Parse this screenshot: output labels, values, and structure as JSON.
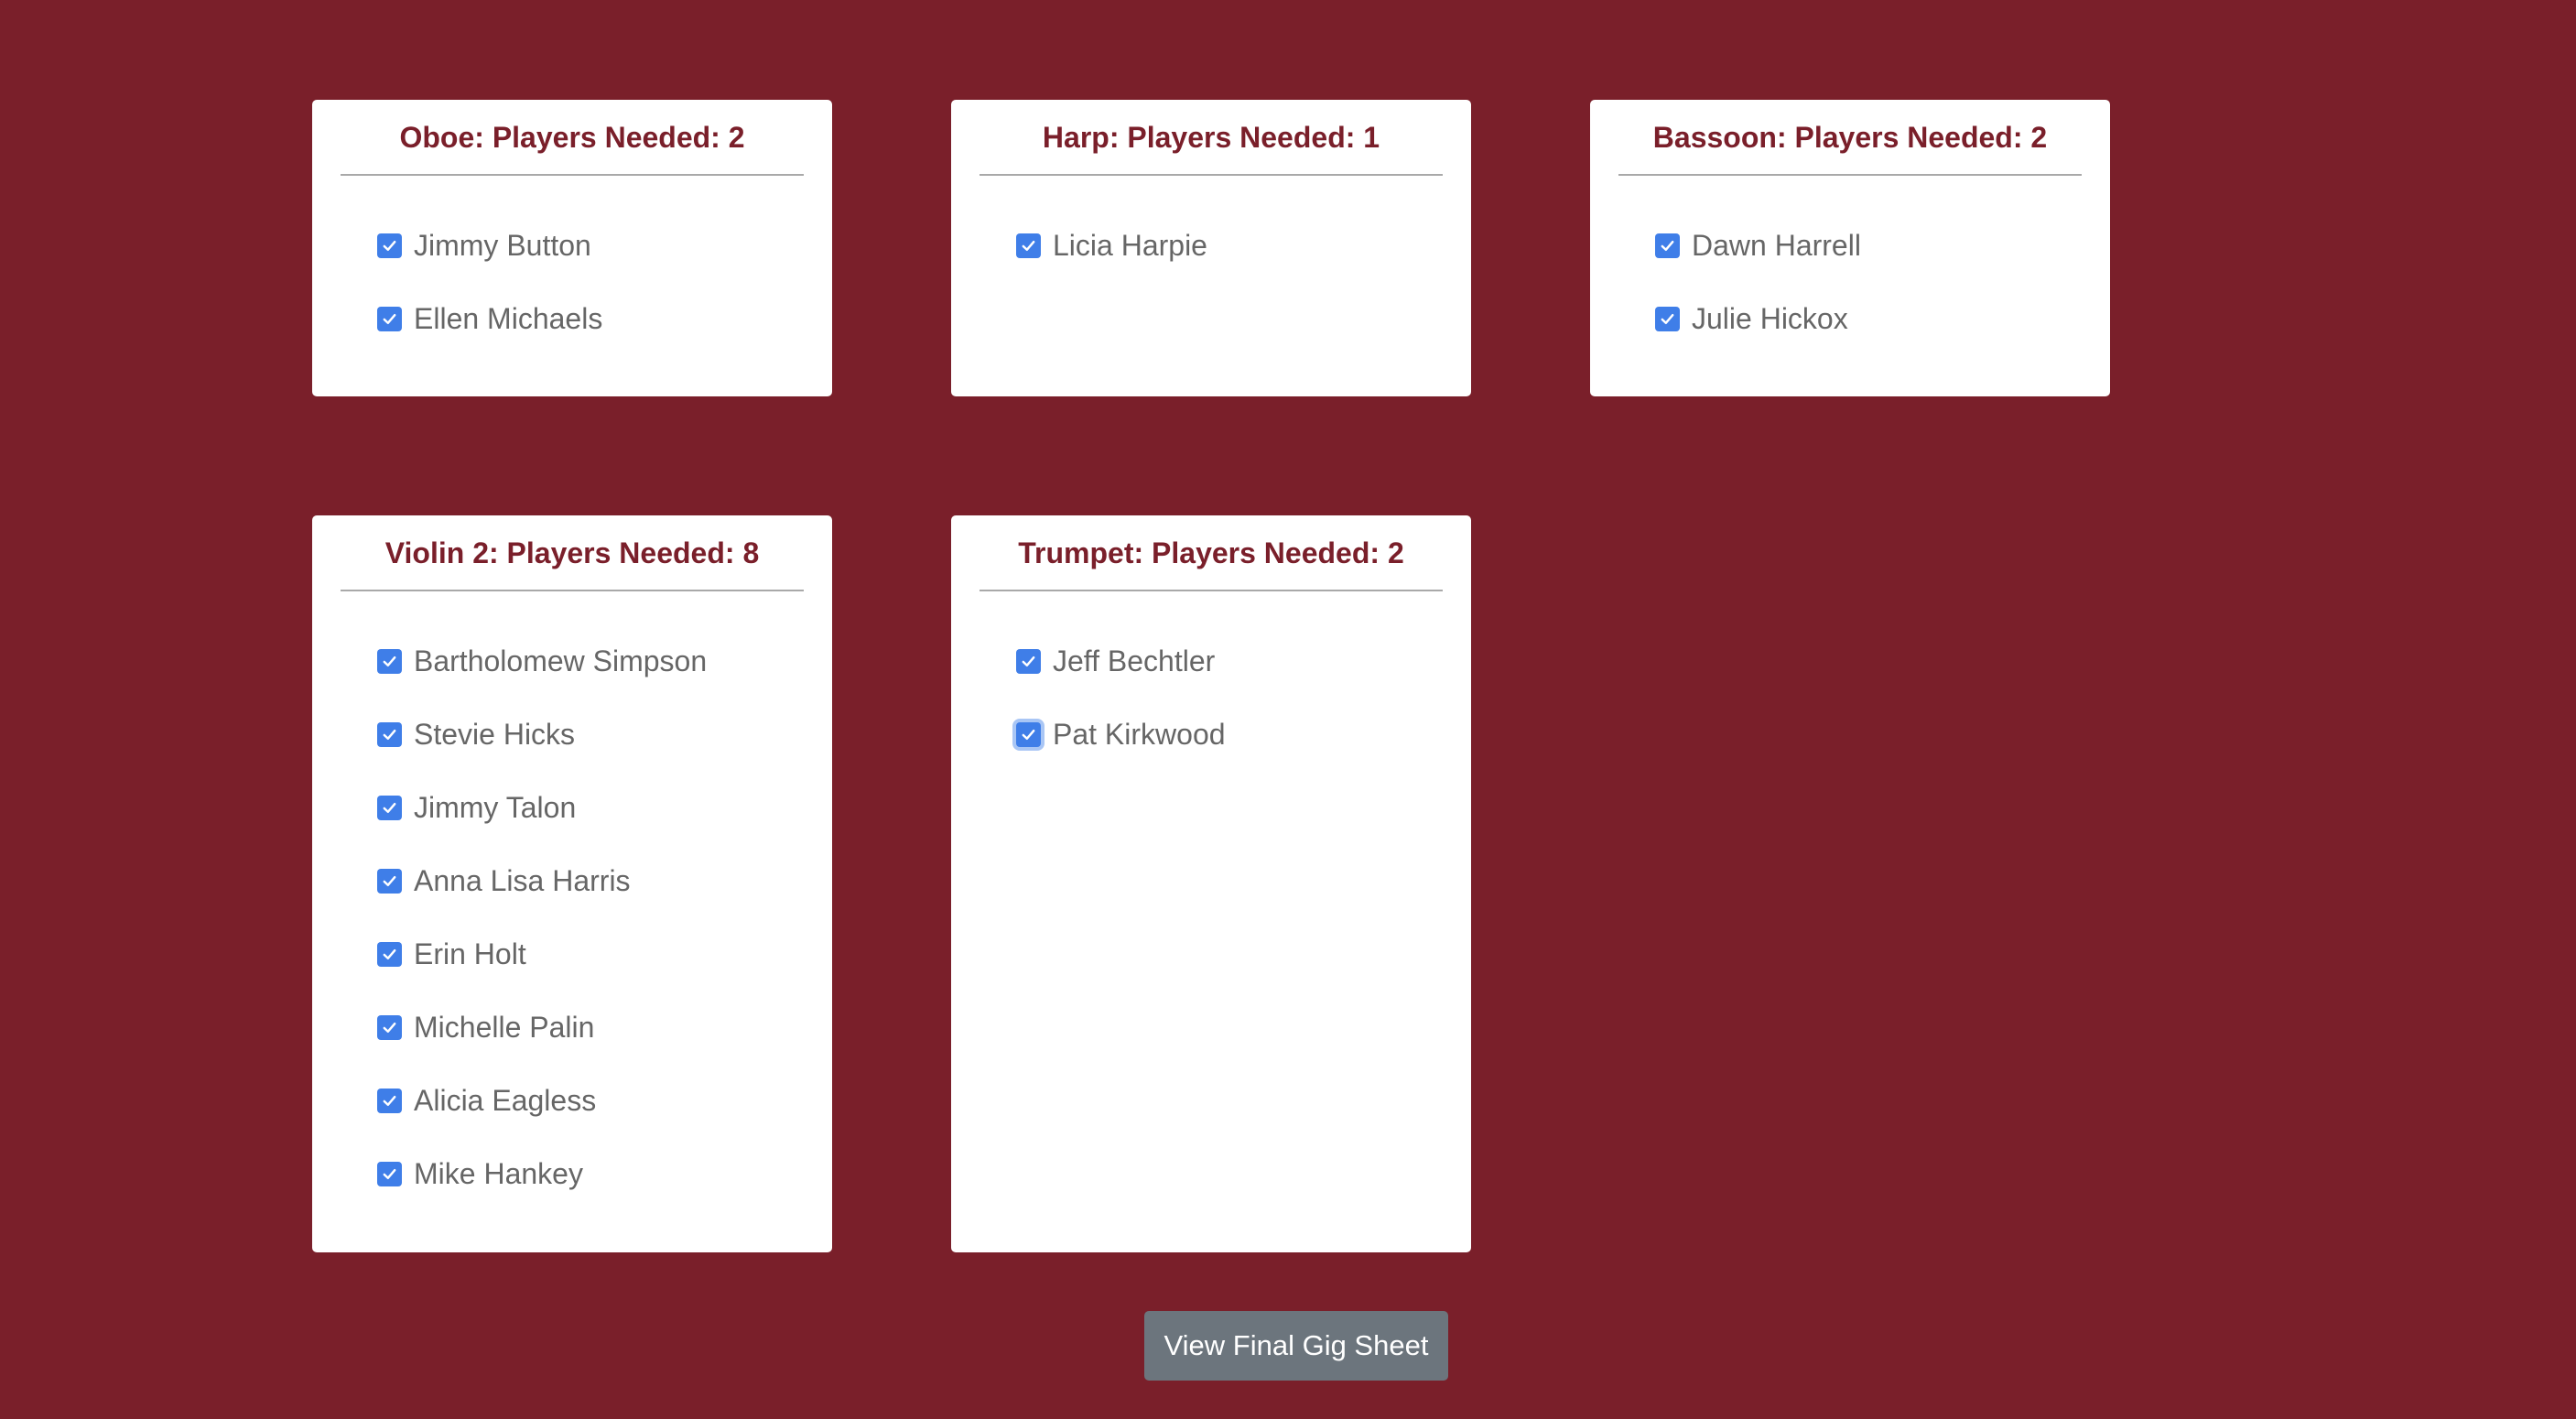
{
  "sections": [
    {
      "id": "oboe",
      "title": "Oboe: Players Needed: 2",
      "players": [
        {
          "name": "Jimmy Button",
          "checked": true
        },
        {
          "name": "Ellen Michaels",
          "checked": true
        }
      ]
    },
    {
      "id": "harp",
      "title": "Harp: Players Needed: 1",
      "players": [
        {
          "name": "Licia Harpie",
          "checked": true
        }
      ]
    },
    {
      "id": "bassoon",
      "title": "Bassoon: Players Needed: 2",
      "players": [
        {
          "name": "Dawn Harrell",
          "checked": true
        },
        {
          "name": "Julie Hickox",
          "checked": true
        }
      ]
    },
    {
      "id": "violin-2",
      "title": "Violin 2: Players Needed: 8",
      "players": [
        {
          "name": "Bartholomew Simpson",
          "checked": true
        },
        {
          "name": "Stevie Hicks",
          "checked": true
        },
        {
          "name": "Jimmy Talon",
          "checked": true
        },
        {
          "name": "Anna Lisa Harris",
          "checked": true
        },
        {
          "name": "Erin Holt",
          "checked": true
        },
        {
          "name": "Michelle Palin",
          "checked": true
        },
        {
          "name": "Alicia Eagless",
          "checked": true
        },
        {
          "name": "Mike Hankey",
          "checked": true
        }
      ]
    },
    {
      "id": "trumpet",
      "title": "Trumpet: Players Needed: 2",
      "players": [
        {
          "name": "Jeff Bechtler",
          "checked": true
        },
        {
          "name": "Pat Kirkwood",
          "checked": true,
          "focused": true
        }
      ]
    }
  ],
  "actions": {
    "view_final_label": "View Final Gig Sheet"
  },
  "colors": {
    "background": "#7a1f2a",
    "card": "#ffffff",
    "title": "#7a1f2a",
    "checkbox": "#3f7ee8",
    "player_text": "#666666",
    "button": "#6c757d"
  }
}
